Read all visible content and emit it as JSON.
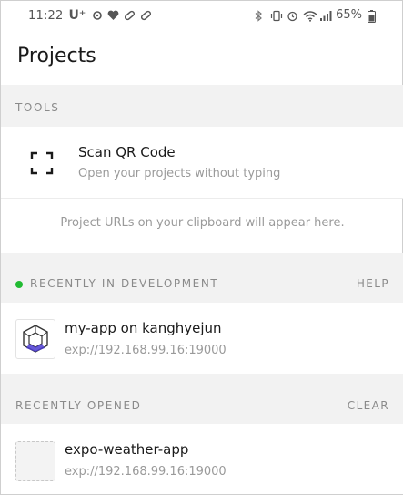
{
  "status_bar": {
    "time": "11:22",
    "carrier": "U⁺",
    "battery": "65%",
    "icons_left": [
      "carrier-icon",
      "app-notification-icon",
      "heart-icon",
      "capsule-icon",
      "capsule-icon"
    ],
    "icons_right": [
      "bluetooth-icon",
      "vibrate-icon",
      "alarm-icon",
      "wifi-icon",
      "signal-icon",
      "battery-icon"
    ]
  },
  "header": {
    "title": "Projects"
  },
  "tools": {
    "section_label": "TOOLS",
    "scan_title": "Scan QR Code",
    "scan_subtitle": "Open your projects without typing",
    "clipboard_hint": "Project URLs on your clipboard will appear here."
  },
  "development": {
    "section_label": "RECENTLY IN DEVELOPMENT",
    "action": "HELP",
    "projects": [
      {
        "name": "my-app on kanghyejun",
        "url": "exp://192.168.99.16:19000"
      }
    ]
  },
  "opened": {
    "section_label": "RECENTLY OPENED",
    "action": "CLEAR",
    "projects": [
      {
        "name": "expo-weather-app",
        "url": "exp://192.168.99.16:19000"
      }
    ]
  },
  "colors": {
    "accent_dot": "#22bb33",
    "section_bg": "#f2f2f2"
  }
}
